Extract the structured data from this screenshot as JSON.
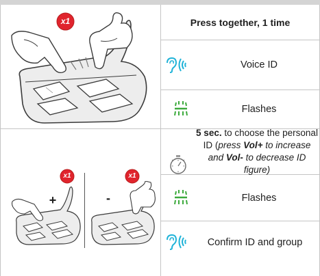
{
  "section1": {
    "badge": "x1",
    "heading": "Press together, 1 time",
    "rows": [
      {
        "icon": "ear-sound-icon",
        "label": "Voice ID"
      },
      {
        "icon": "flash-led-icon",
        "label": "Flashes"
      }
    ]
  },
  "section2": {
    "badge_left": "x1",
    "badge_right": "x1",
    "plus_label": "+",
    "minus_label": "-",
    "timer": {
      "icon": "stopwatch-icon",
      "bold_time": "5 sec.",
      "text_part1": " to choose the personal ID (",
      "text_italic1": "press ",
      "vol_plus": "Vol+",
      "text_italic2": " to increase and ",
      "vol_minus": "Vol-",
      "text_italic3": " to decrease ID figure)"
    },
    "rows": [
      {
        "icon": "flash-led-icon",
        "label": "Flashes"
      },
      {
        "icon": "ear-sound-icon",
        "label": "Confirm ID and group"
      }
    ]
  },
  "colors": {
    "badge_red": "#e0242d",
    "cyan_icon": "#1fb3d8",
    "green_icon": "#3caa3c",
    "divider": "#c4c4c4"
  }
}
